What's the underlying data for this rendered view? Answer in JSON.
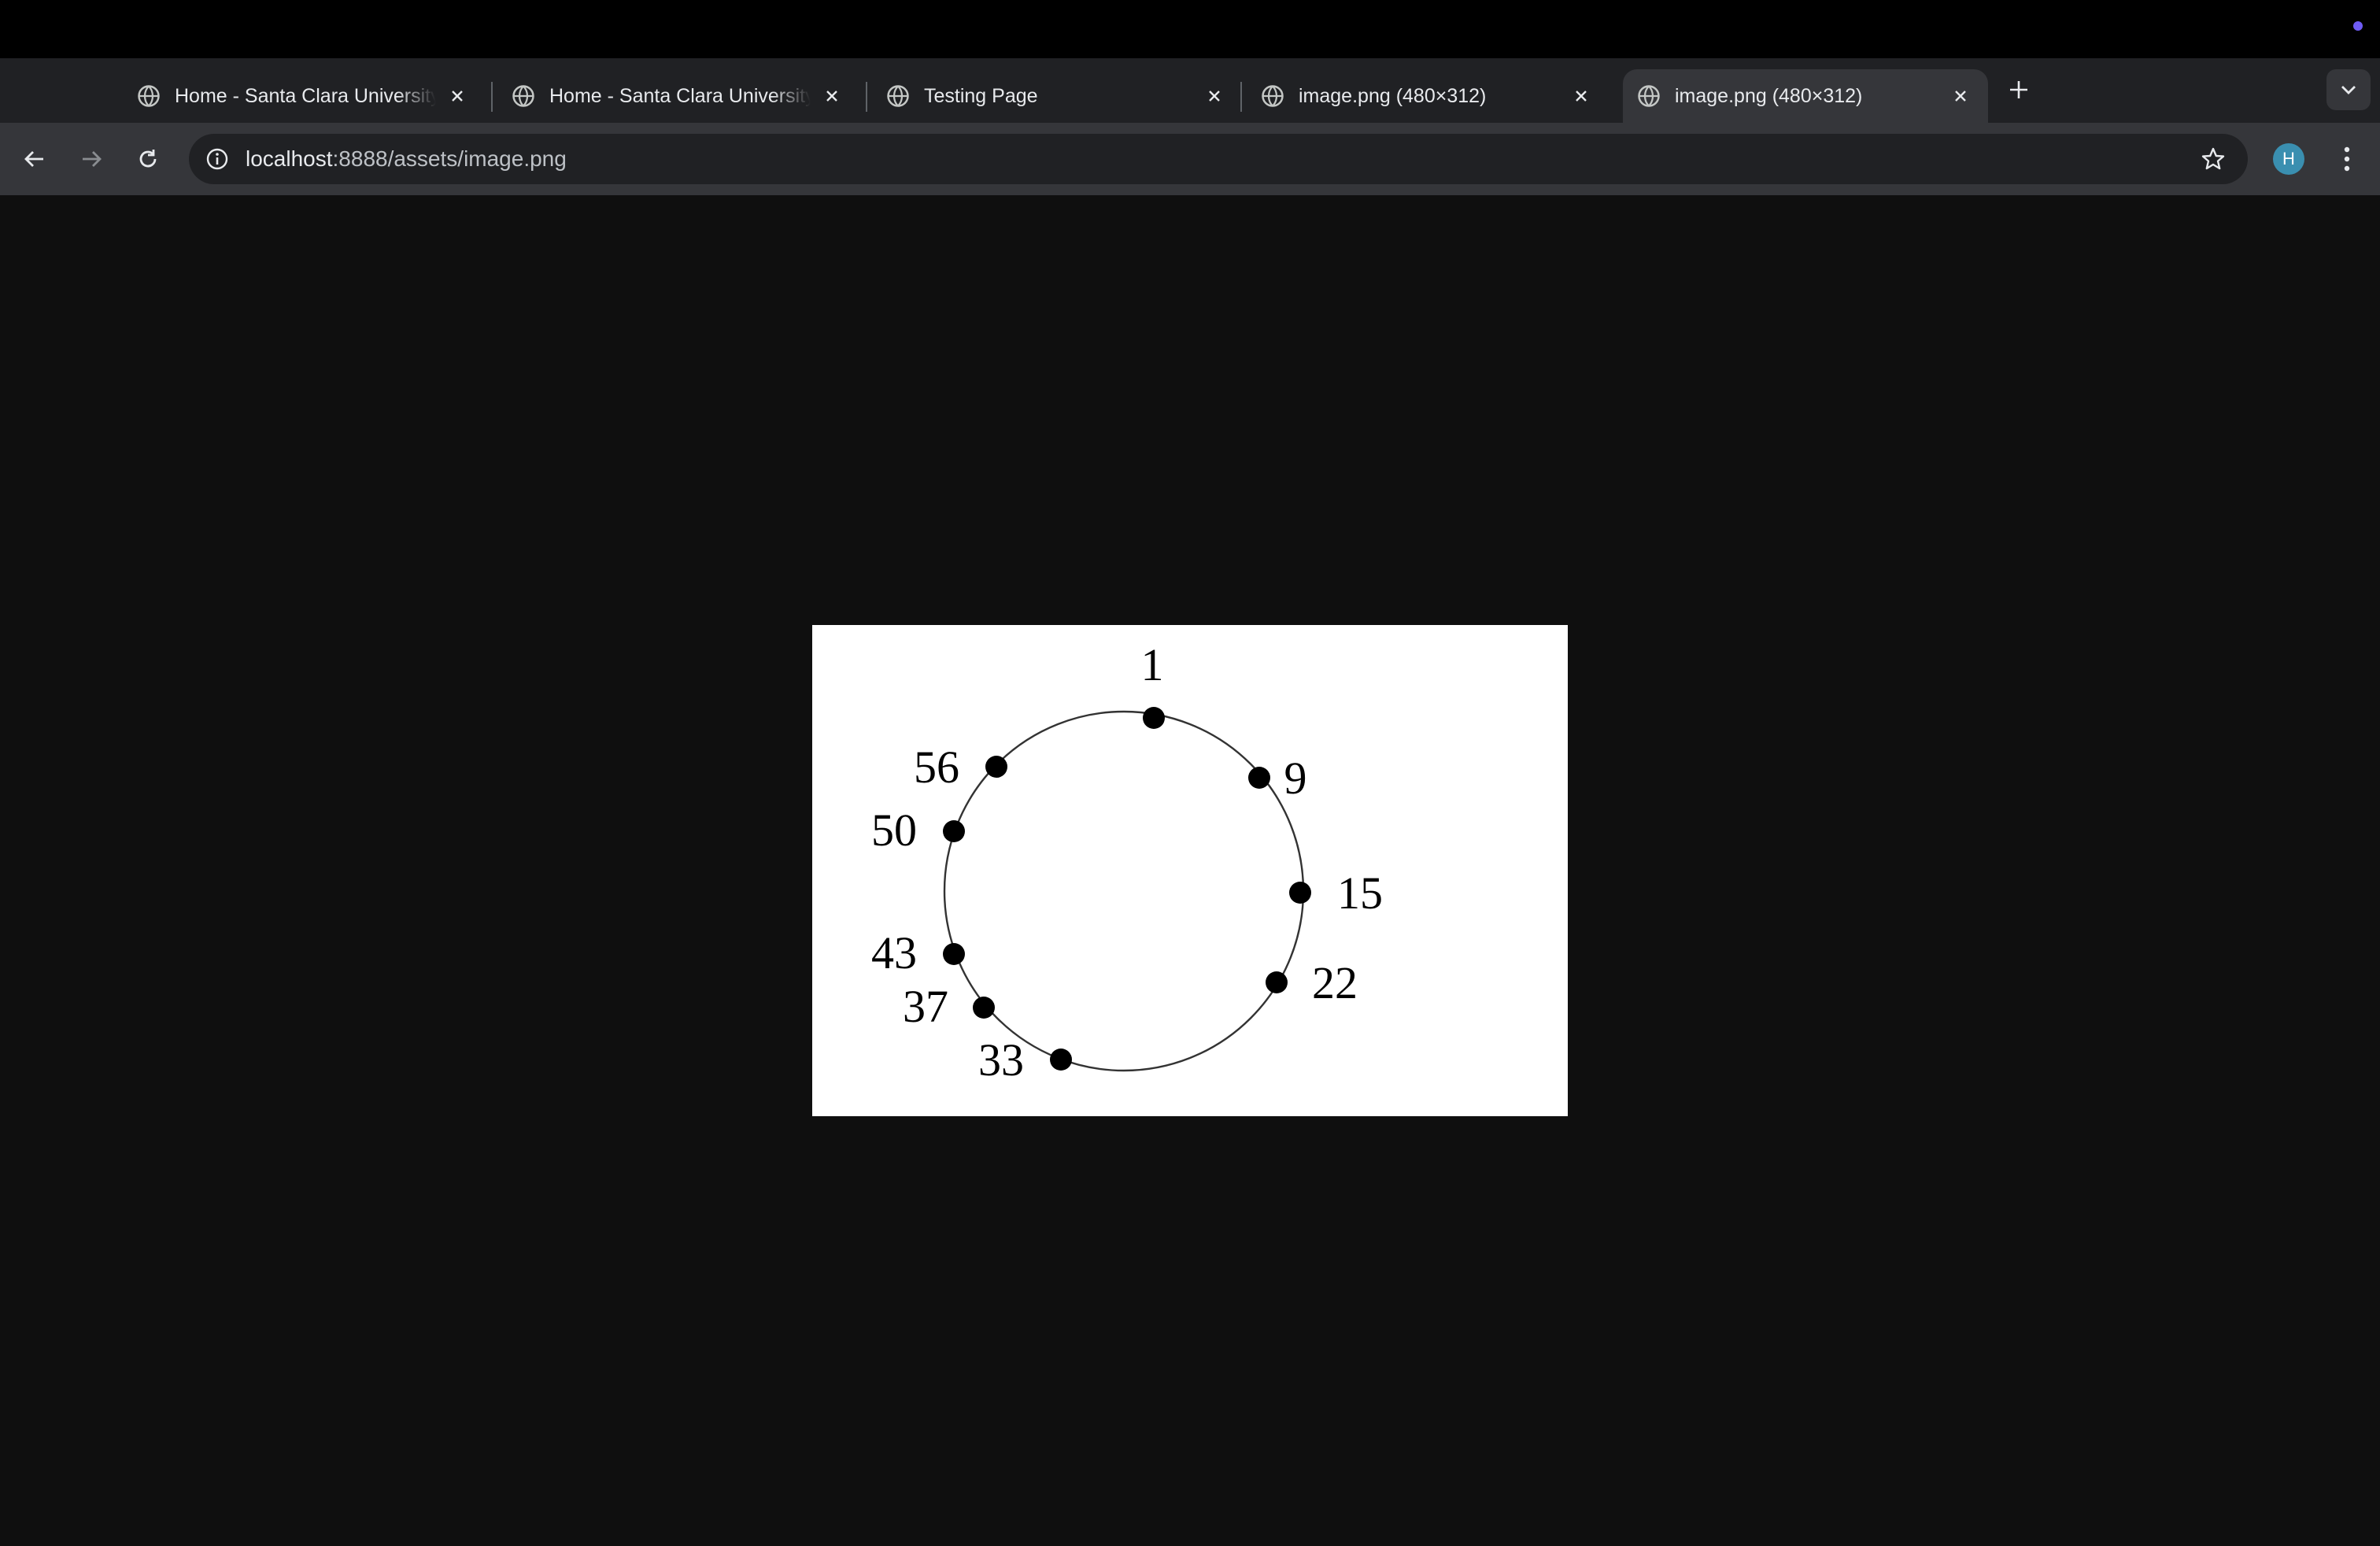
{
  "tabs": [
    {
      "title": "Home - Santa Clara University",
      "icon": "globe-icon",
      "active": false
    },
    {
      "title": "Home - Santa Clara University",
      "icon": "globe-icon",
      "active": false
    },
    {
      "title": "Testing Page",
      "icon": "globe-icon",
      "active": false
    },
    {
      "title": "image.png (480×312)",
      "icon": "globe-icon",
      "active": false
    },
    {
      "title": "image.png (480×312)",
      "icon": "globe-icon",
      "active": true
    }
  ],
  "address_bar": {
    "host": "localhost",
    "path": ":8888/assets/image.png"
  },
  "profile": {
    "initial": "H",
    "color": "#3a8fb0"
  },
  "accent_dot_color": "#6f5cf5",
  "image": {
    "labels": {
      "l1": "1",
      "l9": "9",
      "l15": "15",
      "l22": "22",
      "l33": "33",
      "l37": "37",
      "l43": "43",
      "l50": "50",
      "l56": "56"
    }
  }
}
